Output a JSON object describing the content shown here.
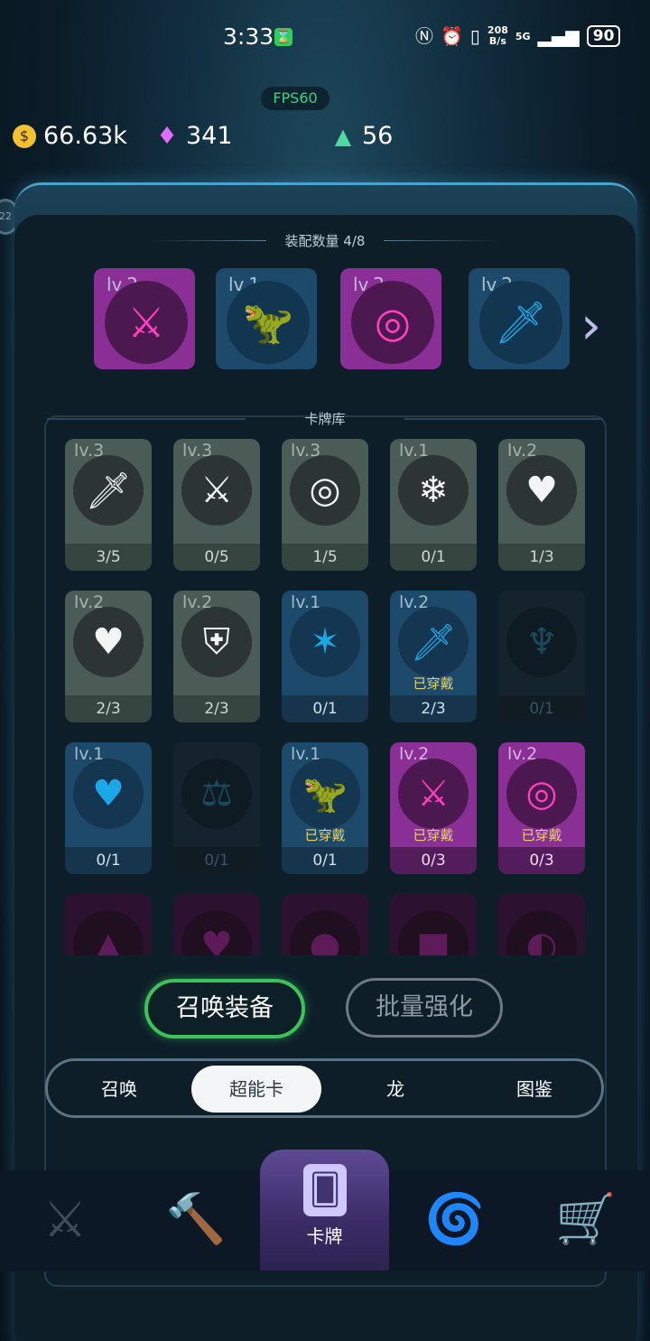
{
  "status_bar": {
    "time": "3:33",
    "net_speed_top": "208",
    "net_speed_bottom": "B/s",
    "signal": "5G",
    "battery": "90"
  },
  "fps": "FPS60",
  "currencies": [
    {
      "icon": "gold-coin-icon",
      "value": "66.63k"
    },
    {
      "icon": "purple-gem-icon",
      "value": "341"
    },
    {
      "icon": "green-triangle-icon",
      "value": "56"
    }
  ],
  "side_badge": "22",
  "equip": {
    "title": "装配数量 4/8",
    "slots": [
      {
        "level": "lv.2",
        "icon": "slash-attack-icon",
        "rarity": "purple"
      },
      {
        "level": "lv.1",
        "icon": "dino-upgrade-icon",
        "rarity": "blue"
      },
      {
        "level": "lv.2",
        "icon": "target-upgrade-icon",
        "rarity": "purple"
      },
      {
        "level": "lv.2",
        "icon": "claw-sword-icon",
        "rarity": "blue"
      }
    ]
  },
  "library": {
    "title": "卡牌库",
    "cards": [
      {
        "level": "lv.3",
        "icon": "sword-icon",
        "count": "3/5",
        "rarity": "gray",
        "worn": ""
      },
      {
        "level": "lv.3",
        "icon": "slash-attack-icon",
        "count": "0/5",
        "rarity": "gray",
        "worn": ""
      },
      {
        "level": "lv.3",
        "icon": "target-icon",
        "count": "1/5",
        "rarity": "gray",
        "worn": ""
      },
      {
        "level": "lv.1",
        "icon": "snowflake-icon",
        "count": "0/1",
        "rarity": "gray",
        "worn": ""
      },
      {
        "level": "lv.2",
        "icon": "broken-heart-minus-icon",
        "count": "1/3",
        "rarity": "gray",
        "worn": ""
      },
      {
        "level": "lv.2",
        "icon": "heart-plus-icon",
        "count": "2/3",
        "rarity": "gray",
        "worn": ""
      },
      {
        "level": "lv.2",
        "icon": "shield-plus-icon",
        "count": "2/3",
        "rarity": "gray",
        "worn": ""
      },
      {
        "level": "lv.1",
        "icon": "dragon-claw-icon",
        "count": "0/1",
        "rarity": "blue",
        "worn": ""
      },
      {
        "level": "lv.2",
        "icon": "claw-sword-icon",
        "count": "2/3",
        "rarity": "blue",
        "worn": "已穿戴"
      },
      {
        "level": "",
        "icon": "trident-icon",
        "count": "0/1",
        "rarity": "dim",
        "worn": ""
      },
      {
        "level": "lv.1",
        "icon": "double-heart-plus-icon",
        "count": "0/1",
        "rarity": "blue",
        "worn": ""
      },
      {
        "level": "",
        "icon": "scales-icon",
        "count": "0/1",
        "rarity": "dim",
        "worn": ""
      },
      {
        "level": "lv.1",
        "icon": "dino-upgrade-icon",
        "count": "0/1",
        "rarity": "blue",
        "worn": "已穿戴"
      },
      {
        "level": "lv.2",
        "icon": "slash-attack-icon",
        "count": "0/3",
        "rarity": "purple",
        "worn": "已穿戴"
      },
      {
        "level": "lv.2",
        "icon": "target-upgrade-icon",
        "count": "0/3",
        "rarity": "purple",
        "worn": "已穿戴"
      },
      {
        "level": "",
        "icon": "flame-icon",
        "count": "",
        "rarity": "dim-purple",
        "worn": ""
      },
      {
        "level": "",
        "icon": "broken-heart-icon",
        "count": "",
        "rarity": "dim-purple",
        "worn": ""
      },
      {
        "level": "",
        "icon": "circle-icon",
        "count": "",
        "rarity": "dim-purple",
        "worn": ""
      },
      {
        "level": "",
        "icon": "chest-icon",
        "count": "",
        "rarity": "dim-purple",
        "worn": ""
      },
      {
        "level": "",
        "icon": "slash-upgrade-icon",
        "count": "",
        "rarity": "dim-purple",
        "worn": ""
      }
    ]
  },
  "buttons": {
    "summon_equip": "召唤装备",
    "batch_upgrade": "批量强化"
  },
  "tabs": [
    {
      "label": "召唤",
      "active": false
    },
    {
      "label": "超能卡",
      "active": true
    },
    {
      "label": "龙",
      "active": false
    },
    {
      "label": "图鉴",
      "active": false
    }
  ],
  "bottom_nav": {
    "items": [
      {
        "icon": "crossed-swords-icon"
      },
      {
        "icon": "hammer-icon"
      },
      {
        "icon": "cards-icon",
        "label": "卡牌",
        "active": true
      },
      {
        "icon": "swirl-icon"
      },
      {
        "icon": "cart-icon"
      }
    ]
  },
  "colors": {
    "purple_rarity": "#8a2f96",
    "blue_rarity": "#1d4a6a",
    "gray_rarity": "#4b5b56",
    "summon_border": "#3bc25a",
    "worn_text": "#e5d36a"
  }
}
